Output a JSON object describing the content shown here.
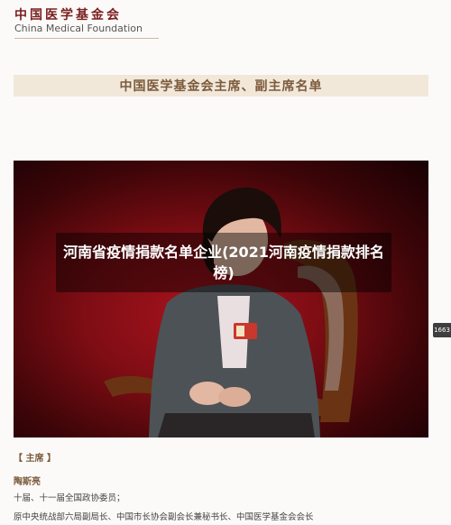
{
  "header": {
    "logo_cn": "中国医学基金会",
    "logo_en": "China Medical Foundation"
  },
  "banner": {
    "title": "中国医学基金会主席、副主席名单"
  },
  "overlay": {
    "title": "河南省疫情捐款名单企业(2021河南疫情捐款排名榜)"
  },
  "side_badge": {
    "text": "1663"
  },
  "content": {
    "section": "【 主席 】",
    "person_name": "陶斯亮",
    "line1": "十届、十一届全国政协委员；",
    "line2": "原中央统战部六局副局长、中国市长协会副会长兼秘书长、中国医学基金会会长"
  },
  "colors": {
    "banner_bg": "#f1e8da",
    "banner_text": "#7b5a3b",
    "photo_bg": "#7f0d14"
  }
}
